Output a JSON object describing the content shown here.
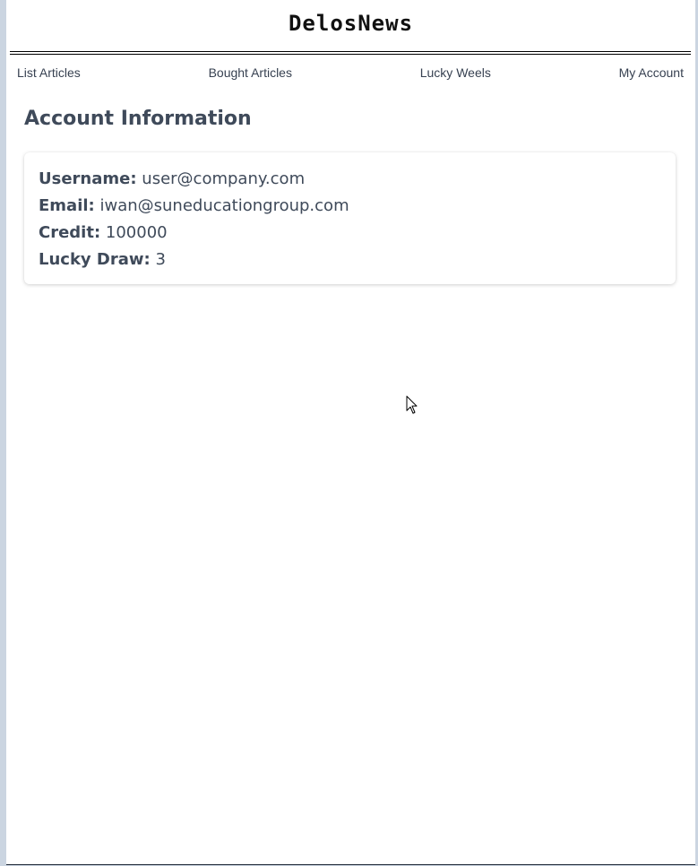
{
  "header": {
    "site_title": "DelosNews"
  },
  "nav": {
    "items": [
      {
        "label": "List Articles"
      },
      {
        "label": "Bought Articles"
      },
      {
        "label": "Lucky Weels"
      },
      {
        "label": "My Account"
      }
    ]
  },
  "account": {
    "title": "Account Information",
    "fields": [
      {
        "label": "Username:",
        "value": "user@company.com"
      },
      {
        "label": "Email:",
        "value": "iwan@suneducationgroup.com"
      },
      {
        "label": "Credit:",
        "value": "100000"
      },
      {
        "label": "Lucky Draw:",
        "value": "3"
      }
    ]
  },
  "colors": {
    "text": "#3f4a5a",
    "nav_text": "#374151",
    "page_bg": "#ffffff",
    "frame_bg": "#cbd5e1"
  },
  "icons": {
    "cursor": "mouse-pointer-icon"
  }
}
